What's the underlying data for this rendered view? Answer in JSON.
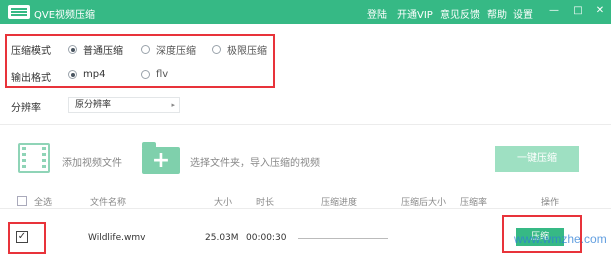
{
  "app": {
    "title": "QVE视频压缩"
  },
  "header": {
    "links": [
      "登陆",
      "开通VIP",
      "意见反馈",
      "帮助",
      "设置"
    ],
    "window_controls": [
      "—",
      "□",
      "✕"
    ]
  },
  "settings": {
    "compress_mode": {
      "label": "压缩模式",
      "options": [
        "普通压缩",
        "深度压缩",
        "极限压缩"
      ],
      "selected": "普通压缩"
    },
    "output_format": {
      "label": "输出格式",
      "options": [
        "mp4",
        "flv"
      ],
      "selected": "mp4"
    },
    "resolution": {
      "label": "分辨率",
      "value": "原分辨率"
    }
  },
  "actions": {
    "add_video": "添加视频文件",
    "add_folder": "选择文件夹，导入压缩的视频",
    "compress_all": "一键压缩"
  },
  "table": {
    "select_all": "全选",
    "columns": [
      "文件名称",
      "大小",
      "时长",
      "压缩进度",
      "压缩后大小",
      "压缩率",
      "操作"
    ],
    "rows": [
      {
        "checked": true,
        "name": "Wildlife.wmv",
        "size": "25.03M",
        "duration": "00:00:30",
        "action": "压缩"
      }
    ]
  },
  "watermark": "www.wmzhe.com"
}
